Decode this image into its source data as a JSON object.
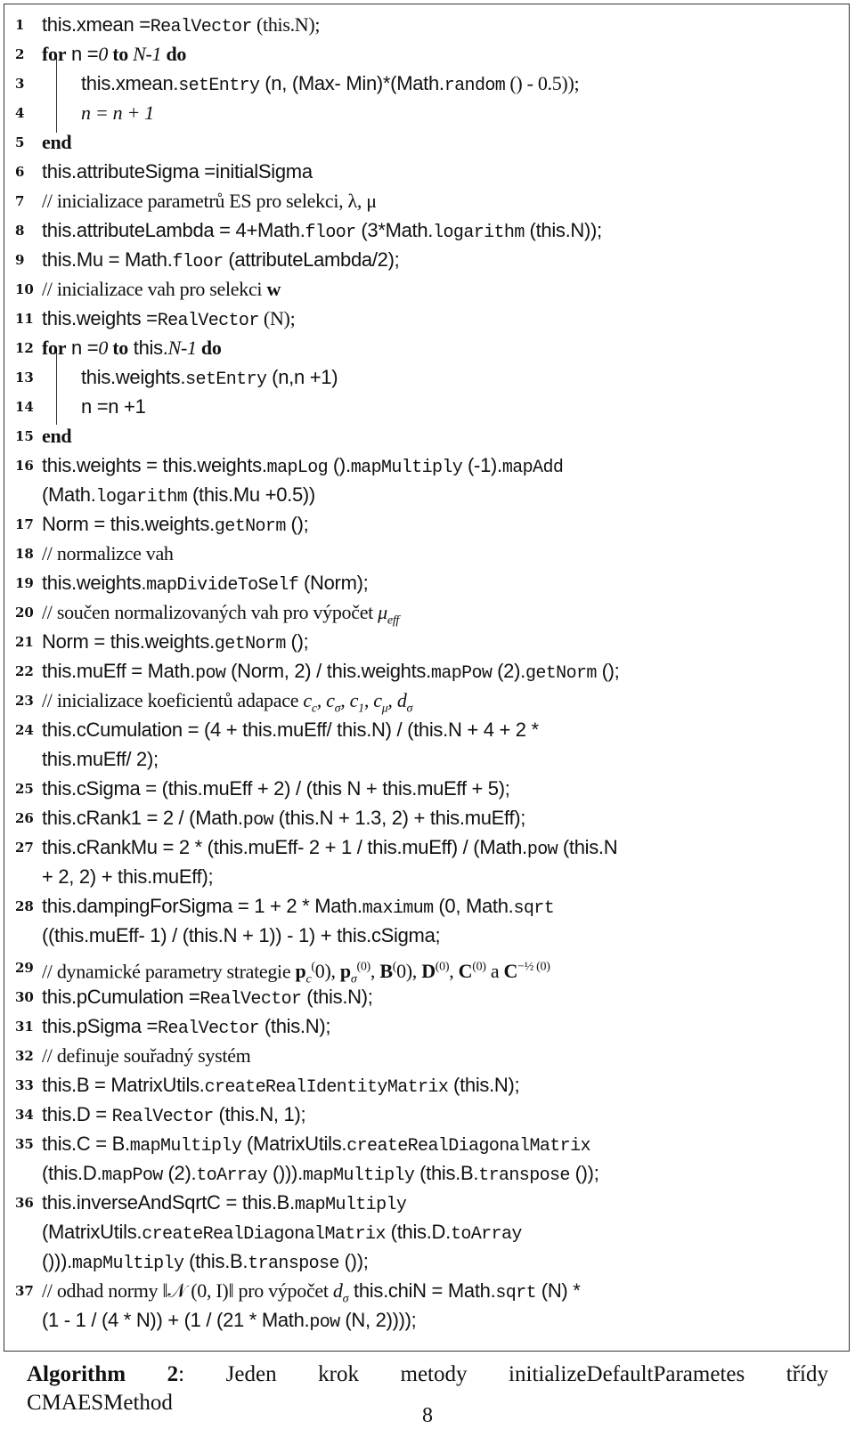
{
  "algorithm": {
    "lines": [
      {
        "n": "1",
        "parts": [
          "this.xmean =",
          "RealVector",
          " (this.N);"
        ]
      },
      {
        "n": "2",
        "parts": [
          "for",
          " n =",
          "0",
          " to ",
          "N-1",
          " do"
        ]
      },
      {
        "n": "3",
        "parts": [
          "this.xmean.",
          "setEntry",
          " (n, (Max- Min)*(Math.",
          "random",
          " () - 0.5));"
        ]
      },
      {
        "n": "4",
        "parts": [
          "n = n + 1"
        ]
      },
      {
        "n": "5",
        "parts": [
          "end"
        ]
      },
      {
        "n": "6",
        "parts": [
          "this.attributeSigma =initialSigma"
        ]
      },
      {
        "n": "7",
        "parts": [
          "// inicializace parametrů ES pro selekci, λ, μ"
        ]
      },
      {
        "n": "8",
        "parts": [
          "this.attributeLambda = 4+Math.",
          "floor",
          " (3*Math.",
          "logarithm",
          " (this.N));"
        ]
      },
      {
        "n": "9",
        "parts": [
          "this.Mu = Math.",
          "floor",
          " (attributeLambda/2);"
        ]
      },
      {
        "n": "10",
        "parts": [
          "// inicializace vah pro selekci ",
          "w"
        ]
      },
      {
        "n": "11",
        "parts": [
          "this.weights =",
          "RealVector",
          " (N);"
        ]
      },
      {
        "n": "12",
        "parts": [
          "for",
          " n =",
          "0",
          " to",
          " this.",
          "N-1",
          " do"
        ]
      },
      {
        "n": "13",
        "parts": [
          "this.weights.",
          "setEntry",
          " (n,n +1)"
        ]
      },
      {
        "n": "14",
        "parts": [
          "n =n +1"
        ]
      },
      {
        "n": "15",
        "parts": [
          "end"
        ]
      },
      {
        "n": "16",
        "parts": [
          "this.weights = this.weights.",
          "mapLog",
          " ().",
          "mapMultiply",
          " (-1).",
          "mapAdd"
        ],
        "cont": [
          "(Math.",
          "logarithm",
          " (this.Mu +0.5))"
        ]
      },
      {
        "n": "17",
        "parts": [
          "Norm = this.weights.",
          "getNorm",
          " ();"
        ]
      },
      {
        "n": "18",
        "parts": [
          "// normalizce vah"
        ]
      },
      {
        "n": "19",
        "parts": [
          "this.weights.",
          "mapDivideToSelf",
          " (Norm);"
        ]
      },
      {
        "n": "20",
        "parts": [
          "// součen normalizovaných vah pro výpočet ",
          "μ",
          "eff"
        ]
      },
      {
        "n": "21",
        "parts": [
          "Norm = this.weights.",
          "getNorm",
          " ();"
        ]
      },
      {
        "n": "22",
        "parts": [
          "this.muEff = Math.",
          "pow",
          " (Norm, 2) / this.weights.",
          "mapPow",
          " (2).",
          "getNorm",
          " ();"
        ]
      },
      {
        "n": "23",
        "parts": [
          "// inicializace koeficientů adapace ",
          "c_c, c_σ, c_1, c_μ, d_σ"
        ]
      },
      {
        "n": "24",
        "parts": [
          "this.cCumulation = (4 + this.muEff/ this.N) / (this.N + 4 + 2 *"
        ],
        "cont": [
          "this.muEff/ 2);"
        ]
      },
      {
        "n": "25",
        "parts": [
          "this.cSigma = (this.muEff + 2) / (this N + this.muEff + 5);"
        ]
      },
      {
        "n": "26",
        "parts": [
          "this.cRank1 = 2 / (Math.",
          "pow",
          " (this.N + 1.3, 2) + this.muEff);"
        ]
      },
      {
        "n": "27",
        "parts": [
          "this.cRankMu = 2 * (this.muEff- 2 + 1 / this.muEff) / (Math.",
          "pow",
          " (this.N"
        ],
        "cont": [
          "+ 2, 2) + this.muEff);"
        ]
      },
      {
        "n": "28",
        "parts": [
          "this.dampingForSigma = 1 + 2 * Math.",
          "maximum",
          " (0, Math.",
          "sqrt"
        ],
        "cont": [
          "((this.muEff- 1) / (this.N + 1)) - 1) + this.cSigma;"
        ]
      },
      {
        "n": "29",
        "parts": [
          "// dynamické parametry strategie ",
          "p_c(0), p_σ(0), B(0), D(0), C(0) a C^-1/2(0)"
        ]
      },
      {
        "n": "30",
        "parts": [
          "this.pCumulation =",
          "RealVector",
          " (this.N);"
        ]
      },
      {
        "n": "31",
        "parts": [
          "this.pSigma =",
          "RealVector",
          " (this.N);"
        ]
      },
      {
        "n": "32",
        "parts": [
          "// definuje souřadný systém"
        ]
      },
      {
        "n": "33",
        "parts": [
          "this.B = MatrixUtils.",
          "createRealIdentityMatrix",
          " (this.N);"
        ]
      },
      {
        "n": "34",
        "parts": [
          "this.D = ",
          "RealVector",
          " (this.N, 1);"
        ]
      },
      {
        "n": "35",
        "parts": [
          "this.C = B.",
          "mapMultiply",
          " (MatrixUtils.",
          "createRealDiagonalMatrix"
        ],
        "cont": [
          "(this.D.",
          "mapPow",
          " (2).",
          "toArray",
          " ())).",
          "mapMultiply",
          " (this.B.",
          "transpose",
          " ());"
        ]
      },
      {
        "n": "36",
        "parts": [
          "this.inverseAndSqrtC = this.B.",
          "mapMultiply"
        ],
        "cont": [
          "(MatrixUtils.",
          "createRealDiagonalMatrix",
          " (this.D.",
          "toArray"
        ],
        "cont2": [
          "())).",
          "mapMultiply",
          " (this.B.",
          "transpose",
          " ());"
        ]
      },
      {
        "n": "37",
        "parts": [
          "// odhad normy ‖𝒩 (0, I)‖ pro výpočet ",
          "d_σ",
          " this.chiN = Math.",
          "sqrt",
          " (N) *"
        ],
        "cont": [
          "(1 - 1 / (4 * N)) + (1 / (21 * Math.",
          "pow",
          " (N, 2))));"
        ]
      }
    ]
  },
  "caption": {
    "label": "Algorithm 2",
    "text": ": Jeden krok metody initializeDefaultParametes třídy",
    "text2": "CMAESMethod"
  },
  "page_number": "8"
}
